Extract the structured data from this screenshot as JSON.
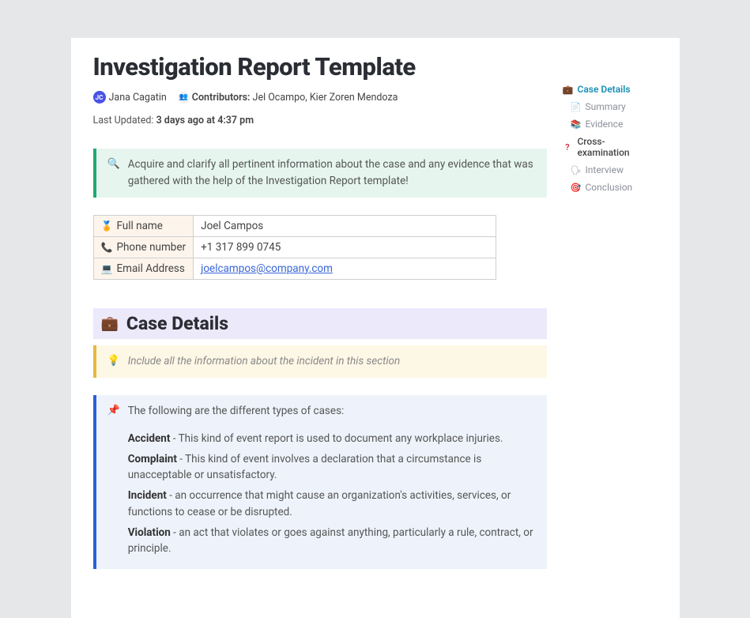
{
  "title": "Investigation Report Template",
  "meta": {
    "author_initials": "JC",
    "author_name": "Jana Cagatin",
    "contributors_label": "Contributors:",
    "contributors_names": "Jel Ocampo, Kier Zoren Mendoza",
    "last_updated_label": "Last Updated:",
    "last_updated_value": "3 days ago at 4:37 pm"
  },
  "intro_callout": "Acquire and clarify all pertinent information about the case and any evidence that was gathered with the help of the Investigation Report template!",
  "contact": {
    "full_name_label": "Full name",
    "full_name_value": "Joel Campos",
    "phone_label": "Phone number",
    "phone_value": "+1 317 899 0745",
    "email_label": "Email Address",
    "email_value": "joelcampos@company.com"
  },
  "section": {
    "heading": "Case Details",
    "yellow_hint": "Include all the information about the incident in this section",
    "blue_intro": "The following are the different types of cases:",
    "defs": [
      {
        "term": "Accident",
        "text": " - This kind of event report is used to document any workplace injuries."
      },
      {
        "term": "Complaint",
        "text": " - This kind of event involves a declaration that a circumstance is unacceptable or unsatisfactory."
      },
      {
        "term": "Incident",
        "text": " - an occurrence that might cause an organization's activities, services, or functions to cease or be disrupted."
      },
      {
        "term": "Violation",
        "text": " - an act that violates or goes against anything, particularly a rule, contract, or principle."
      }
    ]
  },
  "outline": {
    "items": [
      {
        "icon": "briefcase",
        "glyph": "💼",
        "label": "Case Details",
        "level": 1,
        "state": "active"
      },
      {
        "icon": "summary",
        "glyph": "📄",
        "label": "Summary",
        "level": 2,
        "state": ""
      },
      {
        "icon": "evidence",
        "glyph": "📚",
        "label": "Evidence",
        "level": 2,
        "state": ""
      },
      {
        "icon": "question",
        "glyph": "?",
        "label": "Cross-examination",
        "level": 1,
        "state": "cross"
      },
      {
        "icon": "interview",
        "glyph": "🗣",
        "label": "Interview",
        "level": 2,
        "state": ""
      },
      {
        "icon": "conclusion",
        "glyph": "🎯",
        "label": "Conclusion",
        "level": 2,
        "state": ""
      }
    ]
  }
}
